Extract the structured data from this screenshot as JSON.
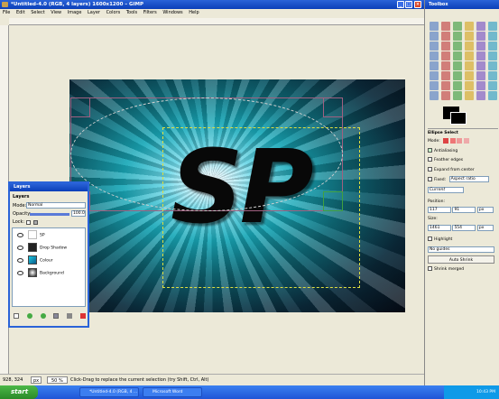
{
  "window": {
    "title": "*Untitled-4.0 (RGB, 4 layers) 1600x1200 – GIMP"
  },
  "menu": [
    "File",
    "Edit",
    "Select",
    "View",
    "Image",
    "Layer",
    "Colors",
    "Tools",
    "Filters",
    "Windows",
    "Help"
  ],
  "canvas": {
    "text": "SP"
  },
  "status": {
    "coords": "928, 324",
    "unit": "px",
    "zoom": "50 %",
    "message": "Click-Drag to replace the current selection (try Shift, Ctrl, Alt)"
  },
  "layers": {
    "title": "Layers",
    "heading": "Layers",
    "mode_label": "Mode:",
    "mode_value": "Normal",
    "opacity_label": "Opacity:",
    "opacity_value": "100.0",
    "lock_label": "Lock:",
    "items": [
      {
        "name": "SP",
        "thumb": "text"
      },
      {
        "name": "Drop Shadow",
        "thumb": "shadow"
      },
      {
        "name": "Colour",
        "thumb": "colour"
      },
      {
        "name": "Background",
        "thumb": "background"
      }
    ]
  },
  "toolbox": {
    "title": "Toolbox",
    "options_title": "Ellipse Select",
    "mode_label": "Mode:",
    "antialiasing": "Antialiasing",
    "feather": "Feather edges",
    "expand": "Expand from center",
    "fixed_label": "Fixed:",
    "fixed_value": "Aspect ratio",
    "current": "Current",
    "position_label": "Position:",
    "pos_x": "117",
    "pos_y": "91",
    "pos_unit": "px",
    "size_label": "Size:",
    "size_w": "1461",
    "size_h": "554",
    "size_unit": "px",
    "highlight": "Highlight",
    "guides": "No guides",
    "auto_shrink": "Auto Shrink",
    "shrink_merged": "Shrink merged"
  },
  "taskbar": {
    "start": "start",
    "tasks": [
      "*Untitled-4.0 (RGB, 4 ...",
      "Microsoft Word"
    ],
    "clock": "10:43 PM"
  },
  "colors": {
    "accent": "#2a63d8",
    "selection": "#dede40"
  }
}
